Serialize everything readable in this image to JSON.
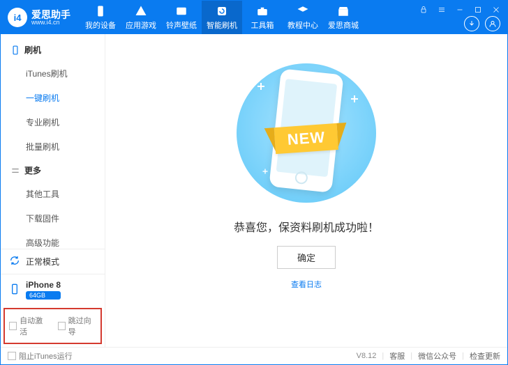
{
  "app": {
    "logo_abbr": "i4",
    "name_cn": "爱思助手",
    "url": "www.i4.cn"
  },
  "tabs": [
    {
      "label": "我的设备"
    },
    {
      "label": "应用游戏"
    },
    {
      "label": "铃声壁纸"
    },
    {
      "label": "智能刷机"
    },
    {
      "label": "工具箱"
    },
    {
      "label": "教程中心"
    },
    {
      "label": "爱思商城"
    }
  ],
  "sidebar": {
    "section1": {
      "title": "刷机",
      "items": [
        "iTunes刷机",
        "一键刷机",
        "专业刷机",
        "批量刷机"
      ]
    },
    "section2": {
      "title": "更多",
      "items": [
        "其他工具",
        "下载固件",
        "高级功能"
      ]
    },
    "mode": "正常模式",
    "device": {
      "name": "iPhone 8",
      "capacity": "64GB"
    },
    "checks": {
      "auto_activate": "自动激活",
      "skip_guide": "跳过向导"
    }
  },
  "main": {
    "ribbon": "NEW",
    "success": "恭喜您，保资料刷机成功啦！",
    "ok": "确定",
    "view_log": "查看日志"
  },
  "statusbar": {
    "block_itunes": "阻止iTunes运行",
    "version": "V8.12",
    "support": "客服",
    "wechat": "微信公众号",
    "check_update": "检查更新"
  }
}
